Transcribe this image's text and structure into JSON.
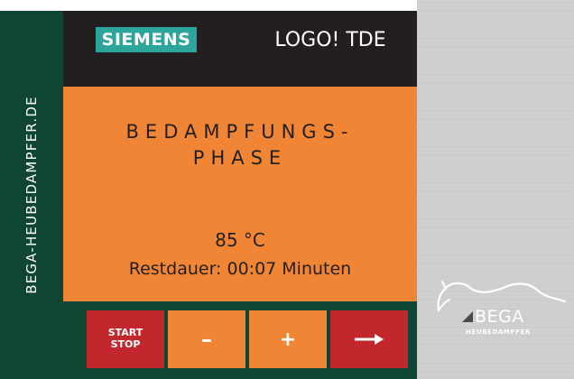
{
  "sidebar": {
    "website": "BEGA-HEUBEDAMPFER.DE"
  },
  "header": {
    "logo_text": "SIEMENS",
    "title": "LOGO! TDE"
  },
  "display": {
    "phase_line1": "BEDAMPFUNGS-",
    "phase_line2": "PHASE",
    "temperature": "85 °C",
    "remaining": "Restdauer: 00:07 Minuten"
  },
  "buttons": {
    "start_line1": "START",
    "start_line2": "STOP",
    "minus": "–",
    "plus": "+",
    "next_icon": "arrow-right-icon"
  },
  "brand": {
    "name": "BEGA",
    "tagline": "HEUBEDAMPFER",
    "logo_icon": "horse-icon"
  },
  "colors": {
    "sidebar": "#0e4535",
    "header": "#231f20",
    "siemens_teal": "#2ea59b",
    "screen_orange": "#f08635",
    "button_red": "#c1272d"
  }
}
